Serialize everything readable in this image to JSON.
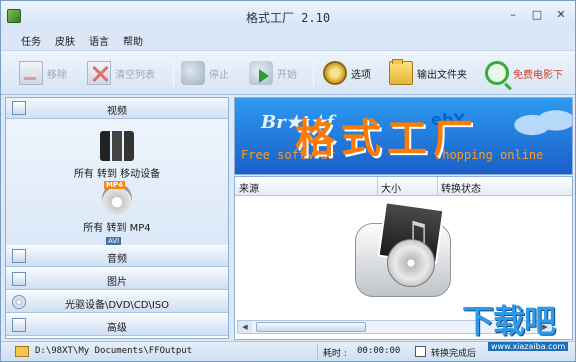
{
  "window": {
    "title": "格式工厂 2.10"
  },
  "menubar": {
    "items": [
      "任务",
      "皮肤",
      "语言",
      "帮助"
    ]
  },
  "toolbar": {
    "remove": "移除",
    "clear": "清空列表",
    "stop": "停止",
    "start": "开始",
    "options": "选项",
    "output_folder": "输出文件夹",
    "free_movies": "免费电影下"
  },
  "left_panel": {
    "video": {
      "label": "视频",
      "items": [
        {
          "label": "所有 转到 移动设备"
        },
        {
          "label": "所有 转到 MP4",
          "badge": "MP4"
        }
      ],
      "next_badge": "AVI"
    },
    "audio": "音频",
    "image": "图片",
    "rom": "光驱设备\\DVD\\CD\\ISO",
    "advanced": "高级"
  },
  "banner": {
    "logo_text": "Br★t★f",
    "title": "格式工厂",
    "free_text": "Free softw",
    "free_text2": "ar",
    "ebay": "ebY",
    "shopping": "shopping online"
  },
  "list": {
    "columns": [
      "来源",
      "大小",
      "转换状态"
    ]
  },
  "statusbar": {
    "path": "D:\\98XT\\My Documents\\FFOutput",
    "time_label": "耗时 :",
    "time": "00:00:00",
    "shutdown_label": "转换完成后"
  },
  "site_watermark": {
    "text": "下载吧",
    "url": "www.xiazaiba.com"
  },
  "colors": {
    "accent": "#1b5fc8",
    "banner_title": "#ff7a00",
    "free_link": "#d83a1a"
  }
}
